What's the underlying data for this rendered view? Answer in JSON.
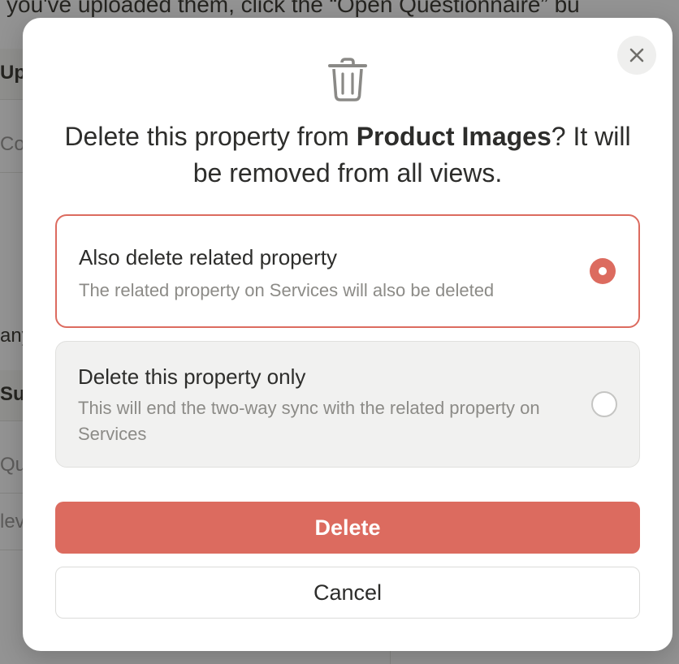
{
  "background": {
    "top_text": "you've uploaded them, click the “Open Questionnaire” bu",
    "labels": [
      "Up",
      "Co",
      "any",
      "Sul",
      "Que",
      "lev"
    ]
  },
  "modal": {
    "close_icon": "close-icon",
    "trash_icon": "trash-icon",
    "title_pre": "Delete this property from ",
    "title_bold": "Product Images",
    "title_post": "? It will be removed from all views.",
    "options": [
      {
        "title": "Also delete related property",
        "description": "The related property on Services will also be deleted",
        "selected": true
      },
      {
        "title": "Delete this property only",
        "description": "This will end the two-way sync with the related property on Services",
        "selected": false
      }
    ],
    "delete_label": "Delete",
    "cancel_label": "Cancel",
    "colors": {
      "accent": "#dc6b5f",
      "overlay": "rgba(15,15,15,0.45)"
    }
  }
}
